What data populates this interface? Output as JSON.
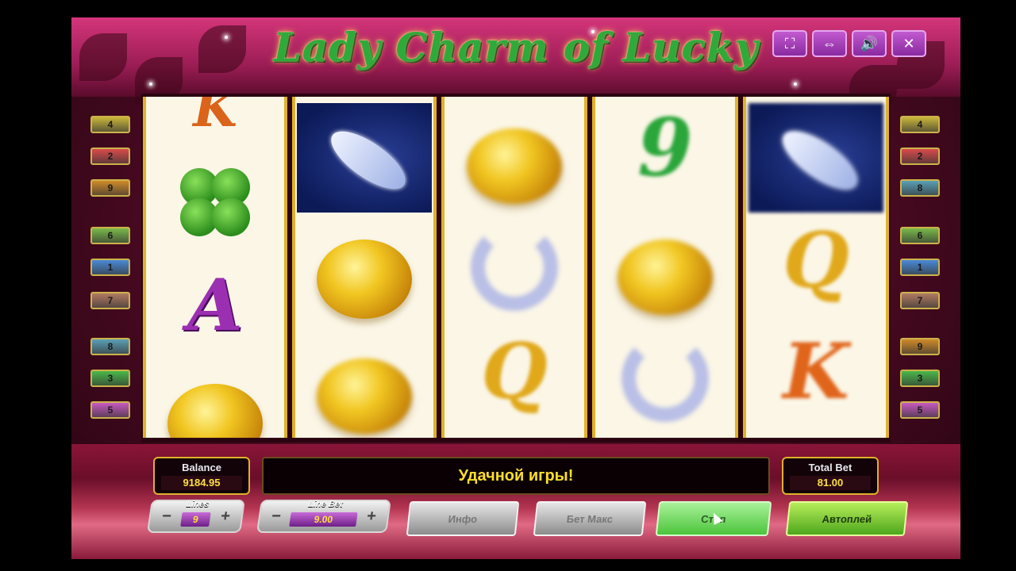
{
  "title": "Lady Charm of Lucky",
  "window_controls": [
    {
      "icon": "fullscreen-icon",
      "glyph": "⛶"
    },
    {
      "icon": "resize-icon",
      "glyph": "⇔"
    },
    {
      "icon": "sound-icon",
      "glyph": "🔊"
    },
    {
      "icon": "close-icon",
      "glyph": "✕"
    }
  ],
  "reels": [
    [
      "K",
      "clover",
      "A",
      "coin"
    ],
    [
      "amulet",
      "coin",
      "coin"
    ],
    [
      "coin",
      "horseshoe",
      "Q"
    ],
    [
      "9",
      "coin",
      "horseshoe"
    ],
    [
      "amulet",
      "Q",
      "K"
    ]
  ],
  "left_lines": [
    {
      "n": "4",
      "color": "#c9b53a"
    },
    {
      "n": "2",
      "color": "#d94b4b"
    },
    {
      "n": "9",
      "color": "#d08a2a"
    },
    {
      "n": "6",
      "color": "#7ab94a"
    },
    {
      "n": "1",
      "color": "#4a8ad6"
    },
    {
      "n": "7",
      "color": "#b07a62"
    },
    {
      "n": "8",
      "color": "#5aa0b6"
    },
    {
      "n": "3",
      "color": "#4ab84a"
    },
    {
      "n": "5",
      "color": "#c85ac0"
    }
  ],
  "right_lines": [
    {
      "n": "4",
      "color": "#c9b53a"
    },
    {
      "n": "2",
      "color": "#d94b4b"
    },
    {
      "n": "8",
      "color": "#5aa0b6"
    },
    {
      "n": "6",
      "color": "#7ab94a"
    },
    {
      "n": "1",
      "color": "#4a8ad6"
    },
    {
      "n": "7",
      "color": "#b07a62"
    },
    {
      "n": "9",
      "color": "#d08a2a"
    },
    {
      "n": "3",
      "color": "#4ab84a"
    },
    {
      "n": "5",
      "color": "#c85ac0"
    }
  ],
  "balance": {
    "label": "Balance",
    "value": "9184.95"
  },
  "message": "Удачной игры!",
  "total_bet": {
    "label": "Total Bet",
    "value": "81.00"
  },
  "lines": {
    "label": "Lines",
    "value": "9",
    "minus": "−",
    "plus": "+"
  },
  "line_bet": {
    "label": "Line Bet",
    "value": "9.00",
    "minus": "−",
    "plus": "+"
  },
  "buttons": {
    "info": "Инфо",
    "bet_max": "Бет Макс",
    "stop": "Стоп",
    "autoplay": "Автоплей"
  }
}
